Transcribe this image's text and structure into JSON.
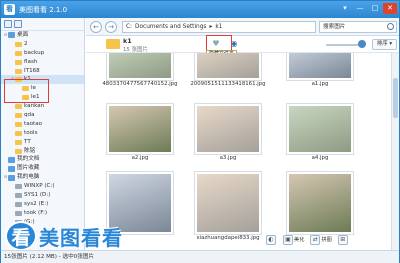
{
  "app": {
    "title": "美图看看 2.1.0",
    "logo_glyph": "看"
  },
  "window_buttons": [
    "▾",
    "—",
    "□",
    "✕"
  ],
  "nav": {
    "back": "←",
    "forward": "→",
    "path": [
      "C:",
      "Documents and Settings",
      "▸",
      "k1"
    ],
    "search_placeholder": "搜索图片"
  },
  "folder": {
    "name": "k1",
    "count": "15 张图片"
  },
  "tooltip": "隐藏文件夹",
  "sort_label": "排序 ▾",
  "tree": [
    {
      "label": "桌面",
      "type": "blue",
      "indent": 0,
      "exp": "⊟"
    },
    {
      "label": "2",
      "type": "fold",
      "indent": 1,
      "exp": ""
    },
    {
      "label": "backup",
      "type": "fold",
      "indent": 1,
      "exp": ""
    },
    {
      "label": "flash",
      "type": "fold",
      "indent": 1,
      "exp": ""
    },
    {
      "label": "IT168",
      "type": "fold",
      "indent": 1,
      "exp": ""
    },
    {
      "label": "k1",
      "type": "fold",
      "indent": 1,
      "exp": "⊟",
      "selected": true
    },
    {
      "label": "le",
      "type": "fold",
      "indent": 2,
      "exp": ""
    },
    {
      "label": "le1",
      "type": "fold",
      "indent": 2,
      "exp": ""
    },
    {
      "label": "kankan",
      "type": "fold",
      "indent": 1,
      "exp": ""
    },
    {
      "label": "qda",
      "type": "fold",
      "indent": 1,
      "exp": ""
    },
    {
      "label": "taotao",
      "type": "fold",
      "indent": 1,
      "exp": ""
    },
    {
      "label": "tools",
      "type": "fold",
      "indent": 1,
      "exp": ""
    },
    {
      "label": "TT",
      "type": "fold",
      "indent": 1,
      "exp": ""
    },
    {
      "label": "陈铭",
      "type": "fold",
      "indent": 1,
      "exp": ""
    },
    {
      "label": "我的文档",
      "type": "blue",
      "indent": 0,
      "exp": ""
    },
    {
      "label": "图片收藏",
      "type": "blue",
      "indent": 0,
      "exp": ""
    },
    {
      "label": "我的电脑",
      "type": "blue",
      "indent": 0,
      "exp": "⊟"
    },
    {
      "label": "WINXP (C:)",
      "type": "drv",
      "indent": 1,
      "exp": ""
    },
    {
      "label": "SYS1 (D:)",
      "type": "drv",
      "indent": 1,
      "exp": ""
    },
    {
      "label": "sys2 (E:)",
      "type": "drv",
      "indent": 1,
      "exp": ""
    },
    {
      "label": "took (F:)",
      "type": "drv",
      "indent": 1,
      "exp": ""
    },
    {
      "label": "(G:)",
      "type": "drv",
      "indent": 1,
      "exp": ""
    },
    {
      "label": "(H:)",
      "type": "drv",
      "indent": 1,
      "exp": ""
    },
    {
      "label": "(I:)",
      "type": "drv",
      "indent": 1,
      "exp": ""
    }
  ],
  "thumbs": [
    {
      "caption": "4803370477567740152.jpg",
      "variant": "c1"
    },
    {
      "caption": "2009051511133418161.jpg",
      "variant": "c2"
    },
    {
      "caption": "a1.jpg",
      "variant": "c3"
    },
    {
      "caption": "a2.jpg",
      "variant": "c4"
    },
    {
      "caption": "a3.jpg",
      "variant": "c2"
    },
    {
      "caption": "a4.jpg",
      "variant": "c1"
    },
    {
      "caption": "",
      "variant": "c3"
    },
    {
      "caption": "xiazhuangdapei833.jpg",
      "variant": "c2"
    },
    {
      "caption": "",
      "variant": "c4"
    }
  ],
  "bottom_tools": [
    {
      "icon": "◐",
      "label": ""
    },
    {
      "icon": "▣",
      "label": "美化"
    },
    {
      "icon": "⇄",
      "label": "拼图"
    },
    {
      "icon": "⊞",
      "label": ""
    }
  ],
  "brand_text": "美图看看",
  "status": "15张图片 (2.12 MB) - 选中0张图片"
}
